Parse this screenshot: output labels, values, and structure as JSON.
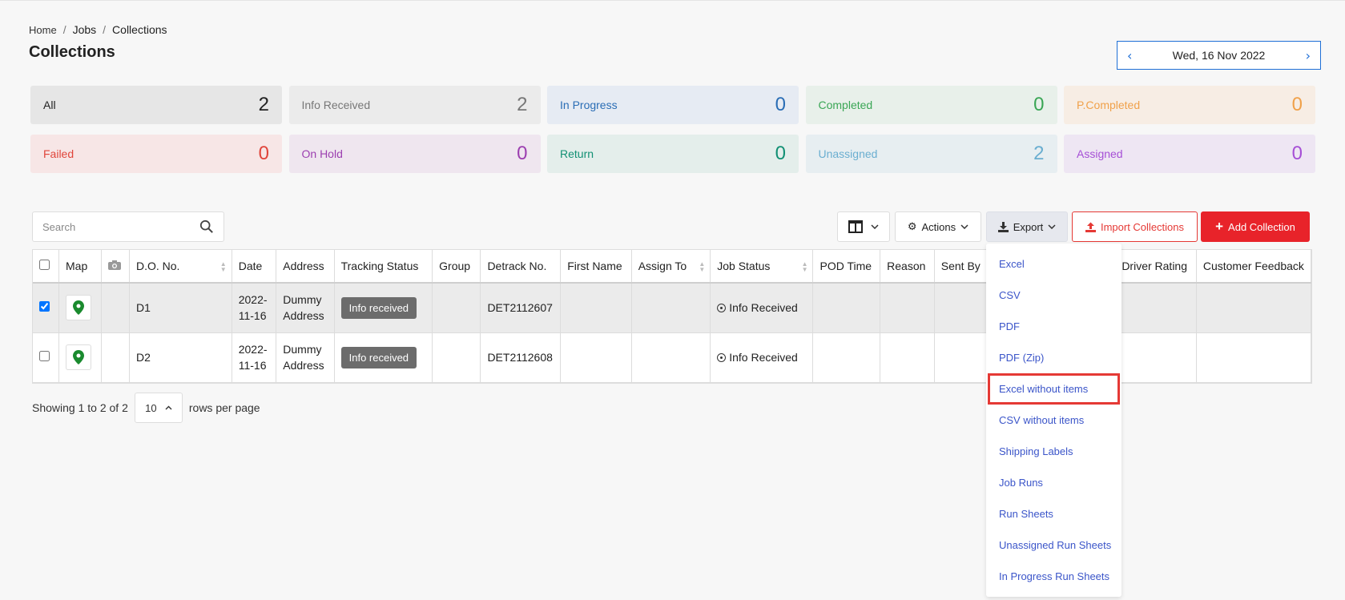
{
  "breadcrumb": {
    "home": "Home",
    "jobs": "Jobs",
    "current": "Collections"
  },
  "page_title": "Collections",
  "date_nav": {
    "date": "Wed, 16 Nov 2022",
    "prev_icon": "chevron-left-icon",
    "next_icon": "chevron-right-icon"
  },
  "status_cards": [
    {
      "label": "All",
      "count": "2",
      "bg": "#e6e6e6",
      "color": "#222222"
    },
    {
      "label": "Info Received",
      "count": "2",
      "bg": "#ebebeb",
      "color": "#777777"
    },
    {
      "label": "In Progress",
      "count": "0",
      "bg": "#e6ebf3",
      "color": "#2a6db5"
    },
    {
      "label": "Completed",
      "count": "0",
      "bg": "#e8f0ea",
      "color": "#3aa655"
    },
    {
      "label": "P.Completed",
      "count": "0",
      "bg": "#f7ede4",
      "color": "#f0a14a"
    },
    {
      "label": "Failed",
      "count": "0",
      "bg": "#f7e6e6",
      "color": "#e0453b"
    },
    {
      "label": "On Hold",
      "count": "0",
      "bg": "#efe6ef",
      "color": "#9c3fb0"
    },
    {
      "label": "Return",
      "count": "0",
      "bg": "#e4eeeb",
      "color": "#129074"
    },
    {
      "label": "Unassigned",
      "count": "2",
      "bg": "#e7eef1",
      "color": "#6aaed0"
    },
    {
      "label": "Assigned",
      "count": "0",
      "bg": "#eee6f3",
      "color": "#a64fd6"
    }
  ],
  "search": {
    "placeholder": "Search"
  },
  "toolbar": {
    "actions_label": "Actions",
    "export_label": "Export",
    "import_label": "Import Collections",
    "add_label": "Add Collection"
  },
  "table": {
    "columns": [
      "Map",
      "D.O. No.",
      "Date",
      "Address",
      "Tracking Status",
      "Group",
      "Detrack No.",
      "First Name",
      "Assign To",
      "Job Status",
      "POD Time",
      "Reason",
      "Sent By",
      "Driver Rating",
      "Customer Feedback"
    ],
    "rows": [
      {
        "selected": true,
        "do_no": "D1",
        "date": "2022-11-16",
        "address": "Dummy Address",
        "tracking_status": "Info received",
        "detrack_no": "DET2112607",
        "job_status": "Info Received"
      },
      {
        "selected": false,
        "do_no": "D2",
        "date": "2022-11-16",
        "address": "Dummy Address",
        "tracking_status": "Info received",
        "detrack_no": "DET2112608",
        "job_status": "Info Received"
      }
    ]
  },
  "pager": {
    "showing": "Showing 1 to 2 of 2",
    "per_page": "10",
    "suffix": "rows per page"
  },
  "export_menu": {
    "items": [
      "Excel",
      "CSV",
      "PDF",
      "PDF (Zip)",
      "Excel without items",
      "CSV without items",
      "Shipping Labels",
      "Job Runs",
      "Run Sheets",
      "Unassigned Run Sheets",
      "In Progress Run Sheets"
    ],
    "highlighted": "Excel without items"
  }
}
